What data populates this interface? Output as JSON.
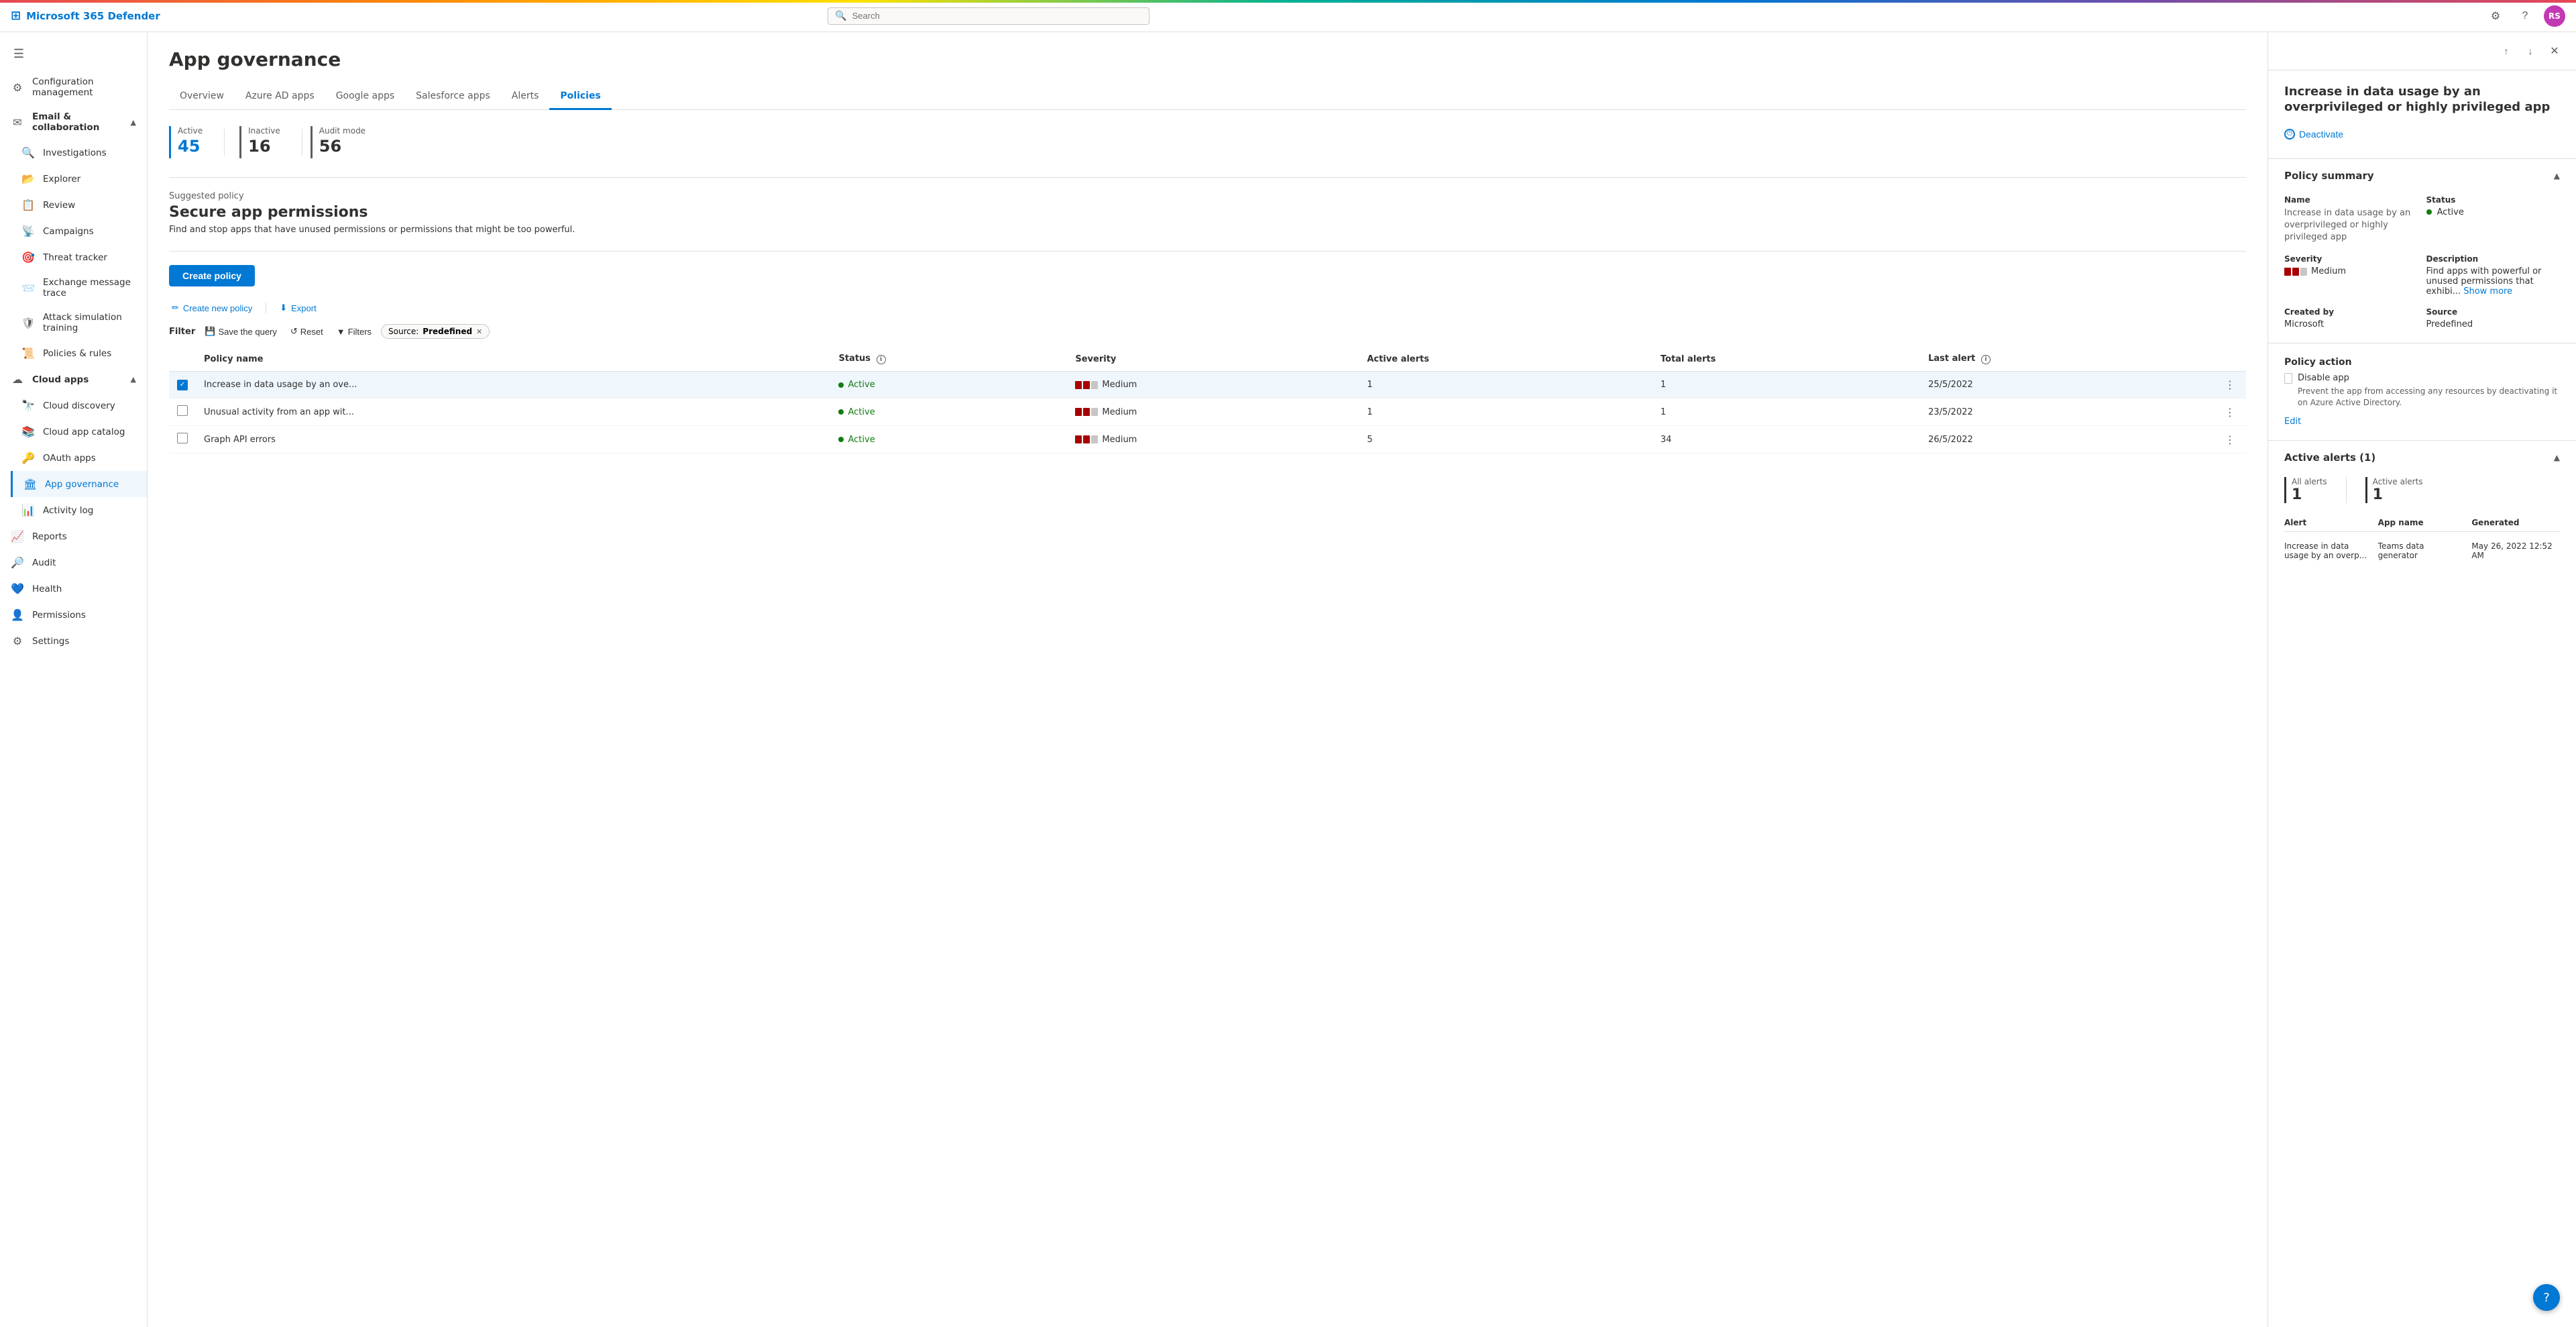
{
  "app": {
    "name": "Microsoft 365 Defender",
    "search_placeholder": "Search"
  },
  "topbar": {
    "avatar_initials": "RS"
  },
  "sidebar": {
    "menu_toggle": "☰",
    "items": [
      {
        "id": "configuration-management",
        "icon": "⚙",
        "label": "Configuration management"
      },
      {
        "id": "email-collaboration",
        "icon": "✉",
        "label": "Email & collaboration",
        "expanded": true
      },
      {
        "id": "investigations",
        "icon": "🔍",
        "label": "Investigations"
      },
      {
        "id": "explorer",
        "icon": "📂",
        "label": "Explorer"
      },
      {
        "id": "review",
        "icon": "📋",
        "label": "Review"
      },
      {
        "id": "campaigns",
        "icon": "📡",
        "label": "Campaigns"
      },
      {
        "id": "threat-tracker",
        "icon": "🎯",
        "label": "Threat tracker"
      },
      {
        "id": "exchange-message-trace",
        "icon": "📨",
        "label": "Exchange message trace"
      },
      {
        "id": "attack-simulation-training",
        "icon": "🛡",
        "label": "Attack simulation training"
      },
      {
        "id": "policies-rules",
        "icon": "📜",
        "label": "Policies & rules"
      },
      {
        "id": "cloud-apps",
        "icon": "☁",
        "label": "Cloud apps",
        "expanded": true
      },
      {
        "id": "cloud-discovery",
        "icon": "🔭",
        "label": "Cloud discovery"
      },
      {
        "id": "cloud-app-catalog",
        "icon": "📚",
        "label": "Cloud app catalog"
      },
      {
        "id": "oauth-apps",
        "icon": "🔑",
        "label": "OAuth apps"
      },
      {
        "id": "app-governance",
        "icon": "🏛",
        "label": "App governance",
        "active": true
      },
      {
        "id": "activity-log",
        "icon": "📊",
        "label": "Activity log"
      },
      {
        "id": "reports",
        "icon": "📈",
        "label": "Reports"
      },
      {
        "id": "audit",
        "icon": "🔎",
        "label": "Audit"
      },
      {
        "id": "health",
        "icon": "💙",
        "label": "Health"
      },
      {
        "id": "permissions",
        "icon": "👤",
        "label": "Permissions"
      },
      {
        "id": "settings",
        "icon": "⚙",
        "label": "Settings"
      }
    ]
  },
  "main": {
    "page_title": "App governance",
    "tabs": [
      {
        "id": "overview",
        "label": "Overview"
      },
      {
        "id": "azure-ad-apps",
        "label": "Azure AD apps"
      },
      {
        "id": "google-apps",
        "label": "Google apps"
      },
      {
        "id": "salesforce-apps",
        "label": "Salesforce apps"
      },
      {
        "id": "alerts",
        "label": "Alerts"
      },
      {
        "id": "policies",
        "label": "Policies",
        "active": true
      }
    ],
    "stats": [
      {
        "label": "Active",
        "value": "45",
        "color_accent": "#0078d4"
      },
      {
        "label": "Inactive",
        "value": "16",
        "color_accent": "#605e5c"
      },
      {
        "label": "Audit mode",
        "value": "56",
        "color_accent": "#605e5c"
      }
    ],
    "suggested_policy": {
      "label": "Suggested policy",
      "title": "Secure app permissions",
      "description": "Find and stop apps that have unused permissions or permissions that might be too powerful."
    },
    "create_policy_label": "Create policy",
    "toolbar": {
      "create_new_policy": "Create new policy",
      "export": "Export"
    },
    "filter": {
      "label": "Filter",
      "save_the_query": "Save the query",
      "reset": "Reset",
      "filters": "Filters",
      "active_chip": {
        "prefix": "Source:",
        "value": "Predefined"
      }
    },
    "table": {
      "columns": [
        {
          "id": "policy-name",
          "label": "Policy name"
        },
        {
          "id": "status",
          "label": "Status"
        },
        {
          "id": "severity",
          "label": "Severity"
        },
        {
          "id": "active-alerts",
          "label": "Active alerts"
        },
        {
          "id": "total-alerts",
          "label": "Total alerts"
        },
        {
          "id": "last-alert",
          "label": "Last alert"
        }
      ],
      "rows": [
        {
          "id": "row-1",
          "selected": true,
          "policy_name": "Increase in data usage by an ove...",
          "status": "Active",
          "severity": "Medium",
          "active_alerts": "1",
          "total_alerts": "1",
          "last_alert": "25/5/2022"
        },
        {
          "id": "row-2",
          "selected": false,
          "policy_name": "Unusual activity from an app wit...",
          "status": "Active",
          "severity": "Medium",
          "active_alerts": "1",
          "total_alerts": "1",
          "last_alert": "23/5/2022"
        },
        {
          "id": "row-3",
          "selected": false,
          "policy_name": "Graph API errors",
          "status": "Active",
          "severity": "Medium",
          "active_alerts": "5",
          "total_alerts": "34",
          "last_alert": "26/5/2022"
        }
      ]
    }
  },
  "detail_panel": {
    "title": "Increase in data usage by an overprivileged or highly privileged app",
    "deactivate_label": "Deactivate",
    "policy_summary": {
      "section_label": "Policy summary",
      "name_label": "Name",
      "name_value": "Increase in data usage by an overprivileged or highly privileged app",
      "status_label": "Status",
      "status_value": "Active",
      "severity_label": "Severity",
      "severity_value": "Medium",
      "description_label": "Description",
      "description_value": "Find apps with powerful or unused permissions that exhibi...",
      "show_more": "Show more",
      "created_by_label": "Created by",
      "created_by_value": "Microsoft",
      "source_label": "Source",
      "source_value": "Predefined"
    },
    "policy_action": {
      "section_label": "Policy action",
      "disable_app_label": "Disable app",
      "disable_app_desc": "Prevent the app from accessing any resources by deactivating it on Azure Active Directory.",
      "edit_label": "Edit"
    },
    "active_alerts": {
      "section_label": "Active alerts (1)",
      "all_alerts_label": "All alerts",
      "all_alerts_value": "1",
      "active_alerts_label": "Active alerts",
      "active_alerts_value": "1",
      "table_columns": [
        "Alert",
        "App name",
        "Generated"
      ],
      "rows": [
        {
          "alert": "Increase in data usage by an overp...",
          "app_name": "Teams data generator",
          "generated": "May 26, 2022 12:52 AM"
        }
      ]
    }
  }
}
